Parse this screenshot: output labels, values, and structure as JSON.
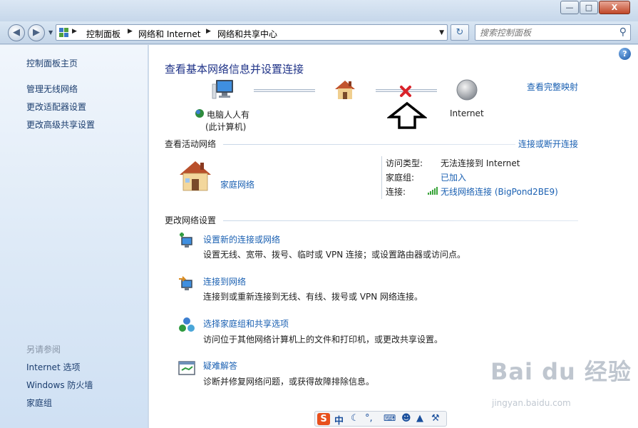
{
  "window": {
    "minimize": "—",
    "maximize": "□",
    "close": "X"
  },
  "address": {
    "crumbs": [
      "控制面板",
      "网络和 Internet",
      "网络和共享中心"
    ],
    "search_placeholder": "搜索控制面板"
  },
  "sidebar": {
    "home": "控制面板主页",
    "tasks": [
      "管理无线网络",
      "更改适配器设置",
      "更改高级共享设置"
    ],
    "see_also_title": "另请参阅",
    "see_also": [
      "Internet 选项",
      "Windows 防火墙",
      "家庭组"
    ]
  },
  "main": {
    "title": "查看基本网络信息并设置连接",
    "full_map": "查看完整映射",
    "map": {
      "computer_line1": "电脑人人有",
      "computer_line2": "(此计算机)",
      "internet": "Internet"
    },
    "active_networks": {
      "title": "查看活动网络",
      "action": "连接或断开连接",
      "network_name": "家庭网络",
      "access_type_label": "访问类型:",
      "access_type_value": "无法连接到 Internet",
      "homegroup_label": "家庭组:",
      "homegroup_value": "已加入",
      "connection_label": "连接:",
      "connection_value": "无线网络连接 (BigPond2BE9)"
    },
    "change_settings": {
      "title": "更改网络设置",
      "items": [
        {
          "link": "设置新的连接或网络",
          "desc": "设置无线、宽带、拨号、临时或 VPN 连接；或设置路由器或访问点。"
        },
        {
          "link": "连接到网络",
          "desc": "连接到或重新连接到无线、有线、拨号或 VPN 网络连接。"
        },
        {
          "link": "选择家庭组和共享选项",
          "desc": "访问位于其他网络计算机上的文件和打印机，或更改共享设置。"
        },
        {
          "link": "疑难解答",
          "desc": "诊断并修复网络问题，或获得故障排除信息。"
        }
      ]
    }
  },
  "watermark": {
    "brand": "Bai du 经验",
    "url": "jingyan.baidu.com"
  },
  "ime": {
    "logo": "S",
    "mode": "中"
  },
  "colors": {
    "link": "#1a60b2",
    "heading": "#1e3287",
    "error_x": "#d9232a"
  }
}
